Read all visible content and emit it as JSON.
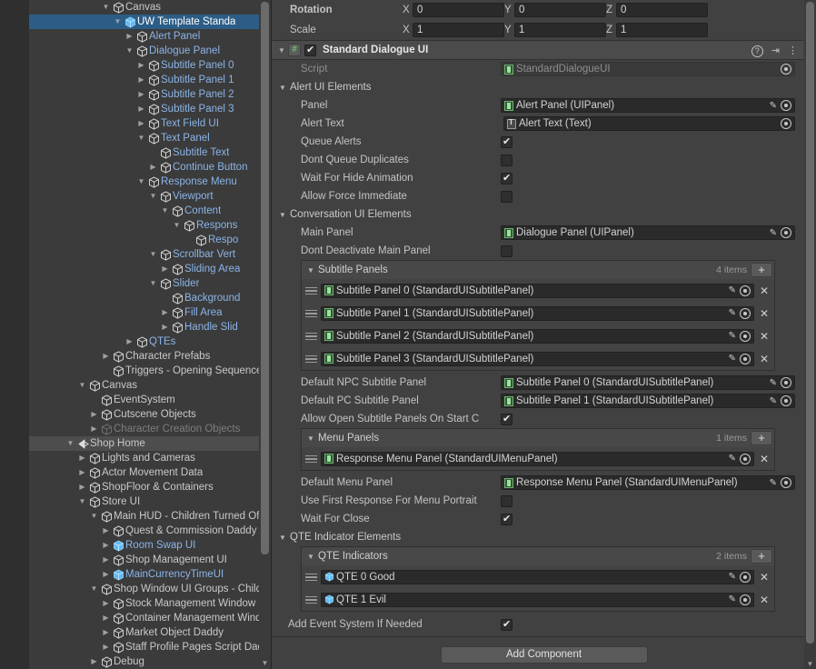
{
  "hierarchy": {
    "rows": [
      {
        "label": "Canvas",
        "indent": 6,
        "twisty": "down",
        "style": "plain",
        "icon": "cube"
      },
      {
        "label": "UW Template Standa",
        "indent": 7,
        "twisty": "down",
        "style": "prefab",
        "icon": "prefab",
        "selected": true,
        "chevron": "›"
      },
      {
        "label": "Alert Panel",
        "indent": 8,
        "twisty": "right",
        "style": "prefab",
        "icon": "cube"
      },
      {
        "label": "Dialogue Panel",
        "indent": 8,
        "twisty": "down",
        "style": "prefab",
        "icon": "cube"
      },
      {
        "label": "Subtitle Panel 0",
        "indent": 9,
        "twisty": "right",
        "style": "prefab",
        "icon": "cube"
      },
      {
        "label": "Subtitle Panel 1",
        "indent": 9,
        "twisty": "right",
        "style": "prefab",
        "icon": "cube"
      },
      {
        "label": "Subtitle Panel 2",
        "indent": 9,
        "twisty": "right",
        "style": "prefab",
        "icon": "cube"
      },
      {
        "label": "Subtitle Panel 3",
        "indent": 9,
        "twisty": "right",
        "style": "prefab",
        "icon": "cube"
      },
      {
        "label": "Text Field UI",
        "indent": 9,
        "twisty": "right",
        "style": "prefab",
        "icon": "cube"
      },
      {
        "label": "Text Panel",
        "indent": 9,
        "twisty": "down",
        "style": "prefab",
        "icon": "cube"
      },
      {
        "label": "Subtitle Text",
        "indent": 10,
        "twisty": "none",
        "style": "prefab",
        "icon": "cube"
      },
      {
        "label": "Continue Button",
        "indent": 10,
        "twisty": "right",
        "style": "prefab",
        "icon": "cube"
      },
      {
        "label": "Response Menu",
        "indent": 9,
        "twisty": "down",
        "style": "prefab",
        "icon": "cube"
      },
      {
        "label": "Viewport",
        "indent": 10,
        "twisty": "down",
        "style": "prefab",
        "icon": "cube"
      },
      {
        "label": "Content",
        "indent": 11,
        "twisty": "down",
        "style": "prefab",
        "icon": "cube"
      },
      {
        "label": "Respons",
        "indent": 12,
        "twisty": "down",
        "style": "prefab",
        "icon": "cube"
      },
      {
        "label": "Respo",
        "indent": 13,
        "twisty": "none",
        "style": "prefab",
        "icon": "cube"
      },
      {
        "label": "Scrollbar Vert",
        "indent": 10,
        "twisty": "down",
        "style": "prefab",
        "icon": "cube"
      },
      {
        "label": "Sliding Area",
        "indent": 11,
        "twisty": "right",
        "style": "prefab",
        "icon": "cube"
      },
      {
        "label": "Slider",
        "indent": 10,
        "twisty": "down",
        "style": "prefab",
        "icon": "cube"
      },
      {
        "label": "Background",
        "indent": 11,
        "twisty": "none",
        "style": "prefab",
        "icon": "cube"
      },
      {
        "label": "Fill Area",
        "indent": 11,
        "twisty": "right",
        "style": "prefab",
        "icon": "cube"
      },
      {
        "label": "Handle Slid",
        "indent": 11,
        "twisty": "right",
        "style": "prefab",
        "icon": "cube"
      },
      {
        "label": "QTEs",
        "indent": 8,
        "twisty": "right",
        "style": "prefab",
        "icon": "cube"
      },
      {
        "label": "Character Prefabs",
        "indent": 6,
        "twisty": "right",
        "style": "plain",
        "icon": "cube"
      },
      {
        "label": "Triggers - Opening Sequence",
        "indent": 6,
        "twisty": "none",
        "style": "plain",
        "icon": "cube"
      },
      {
        "label": "Canvas",
        "indent": 4,
        "twisty": "down",
        "style": "plain",
        "icon": "cube"
      },
      {
        "label": "EventSystem",
        "indent": 5,
        "twisty": "none",
        "style": "plain",
        "icon": "cube"
      },
      {
        "label": "Cutscene Objects",
        "indent": 5,
        "twisty": "right",
        "style": "plain",
        "icon": "cube"
      },
      {
        "label": "Character Creation Objects",
        "indent": 5,
        "twisty": "right",
        "style": "dim",
        "icon": "cube-dim"
      },
      {
        "label": "Shop Home",
        "indent": 3,
        "twisty": "down",
        "style": "plain",
        "icon": "scene",
        "scene": true,
        "kebab": "⋮"
      },
      {
        "label": "Lights and Cameras",
        "indent": 4,
        "twisty": "right",
        "style": "plain",
        "icon": "cube"
      },
      {
        "label": "Actor Movement Data",
        "indent": 4,
        "twisty": "right",
        "style": "plain",
        "icon": "cube"
      },
      {
        "label": "ShopFloor & Containers",
        "indent": 4,
        "twisty": "right",
        "style": "plain",
        "icon": "cube"
      },
      {
        "label": "Store UI",
        "indent": 4,
        "twisty": "down",
        "style": "plain",
        "icon": "cube"
      },
      {
        "label": "Main HUD - Children Turned Off f",
        "indent": 5,
        "twisty": "down",
        "style": "plain",
        "icon": "cube"
      },
      {
        "label": "Quest & Commission Daddy Scr",
        "indent": 6,
        "twisty": "right",
        "style": "plain",
        "icon": "cube"
      },
      {
        "label": "Room Swap UI",
        "indent": 6,
        "twisty": "right",
        "style": "prefab",
        "icon": "prefab",
        "chevron": "›"
      },
      {
        "label": "Shop Management UI",
        "indent": 6,
        "twisty": "right",
        "style": "plain",
        "icon": "cube"
      },
      {
        "label": "MainCurrencyTimeUI",
        "indent": 6,
        "twisty": "right",
        "style": "prefab",
        "icon": "prefab",
        "chevron": "›"
      },
      {
        "label": "Shop Window UI Groups - Childre",
        "indent": 5,
        "twisty": "down",
        "style": "plain",
        "icon": "cube"
      },
      {
        "label": "Stock Management Window Inv",
        "indent": 6,
        "twisty": "right",
        "style": "plain",
        "icon": "cube"
      },
      {
        "label": "Container Management Window",
        "indent": 6,
        "twisty": "right",
        "style": "plain",
        "icon": "cube"
      },
      {
        "label": "Market Object Daddy",
        "indent": 6,
        "twisty": "right",
        "style": "plain",
        "icon": "cube"
      },
      {
        "label": "Staff Profile Pages Script Daddy",
        "indent": 6,
        "twisty": "right",
        "style": "plain",
        "icon": "cube"
      },
      {
        "label": "Debug",
        "indent": 5,
        "twisty": "right",
        "style": "plain",
        "icon": "cube"
      }
    ]
  },
  "inspector": {
    "transform": {
      "rotation": {
        "label": "Rotation",
        "x_axis": "X",
        "x": "0",
        "y_axis": "Y",
        "y": "0",
        "z_axis": "Z",
        "z": "0"
      },
      "scale": {
        "label": "Scale",
        "x_axis": "X",
        "x": "1",
        "y_axis": "Y",
        "y": "1",
        "z_axis": "Z",
        "z": "1"
      }
    },
    "component": {
      "title": "Standard Dialogue UI",
      "enabled": true,
      "script_label": "Script",
      "script_value": "StandardDialogueUI"
    },
    "sections": {
      "alert": "Alert UI Elements",
      "conversation": "Conversation UI Elements",
      "qte": "QTE Indicator Elements"
    },
    "alert_fields": {
      "panel_label": "Panel",
      "panel_value": "Alert Panel (UIPanel)",
      "alert_text_label": "Alert Text",
      "alert_text_value": "Alert Text (Text)",
      "queue_alerts_label": "Queue Alerts",
      "queue_alerts": true,
      "dont_queue_label": "Dont Queue Duplicates",
      "dont_queue": false,
      "wait_hide_label": "Wait For Hide Animation",
      "wait_hide": true,
      "force_immediate_label": "Allow Force Immediate",
      "force_immediate": false
    },
    "conversation_fields": {
      "main_panel_label": "Main Panel",
      "main_panel_value": "Dialogue Panel (UIPanel)",
      "dont_deactivate_label": "Dont Deactivate Main Panel",
      "dont_deactivate": false,
      "subtitle_panels_label": "Subtitle Panels",
      "subtitle_panels_count": "4 items",
      "subtitle_panels": [
        "Subtitle Panel 0 (StandardUISubtitlePanel)",
        "Subtitle Panel 1 (StandardUISubtitlePanel)",
        "Subtitle Panel 2 (StandardUISubtitlePanel)",
        "Subtitle Panel 3 (StandardUISubtitlePanel)"
      ],
      "default_npc_label": "Default NPC Subtitle Panel",
      "default_npc_value": "Subtitle Panel 0 (StandardUISubtitlePanel)",
      "default_pc_label": "Default PC Subtitle Panel",
      "default_pc_value": "Subtitle Panel 1 (StandardUISubtitlePanel)",
      "allow_open_label": "Allow Open Subtitle Panels On Start C",
      "allow_open": true,
      "menu_panels_label": "Menu Panels",
      "menu_panels_count": "1 items",
      "menu_panels": [
        "Response Menu Panel (StandardUIMenuPanel)"
      ],
      "default_menu_label": "Default Menu Panel",
      "default_menu_value": "Response Menu Panel (StandardUIMenuPanel)",
      "use_first_response_label": "Use First Response For Menu Portrait",
      "use_first_response": false,
      "wait_for_close_label": "Wait For Close",
      "wait_for_close": true
    },
    "qte_fields": {
      "indicators_label": "QTE Indicators",
      "indicators_count": "2 items",
      "indicators": [
        "QTE 0 Good",
        "QTE 1 Evil"
      ],
      "add_event_label": "Add Event System If Needed",
      "add_event": true
    },
    "add_component": "Add Component"
  }
}
